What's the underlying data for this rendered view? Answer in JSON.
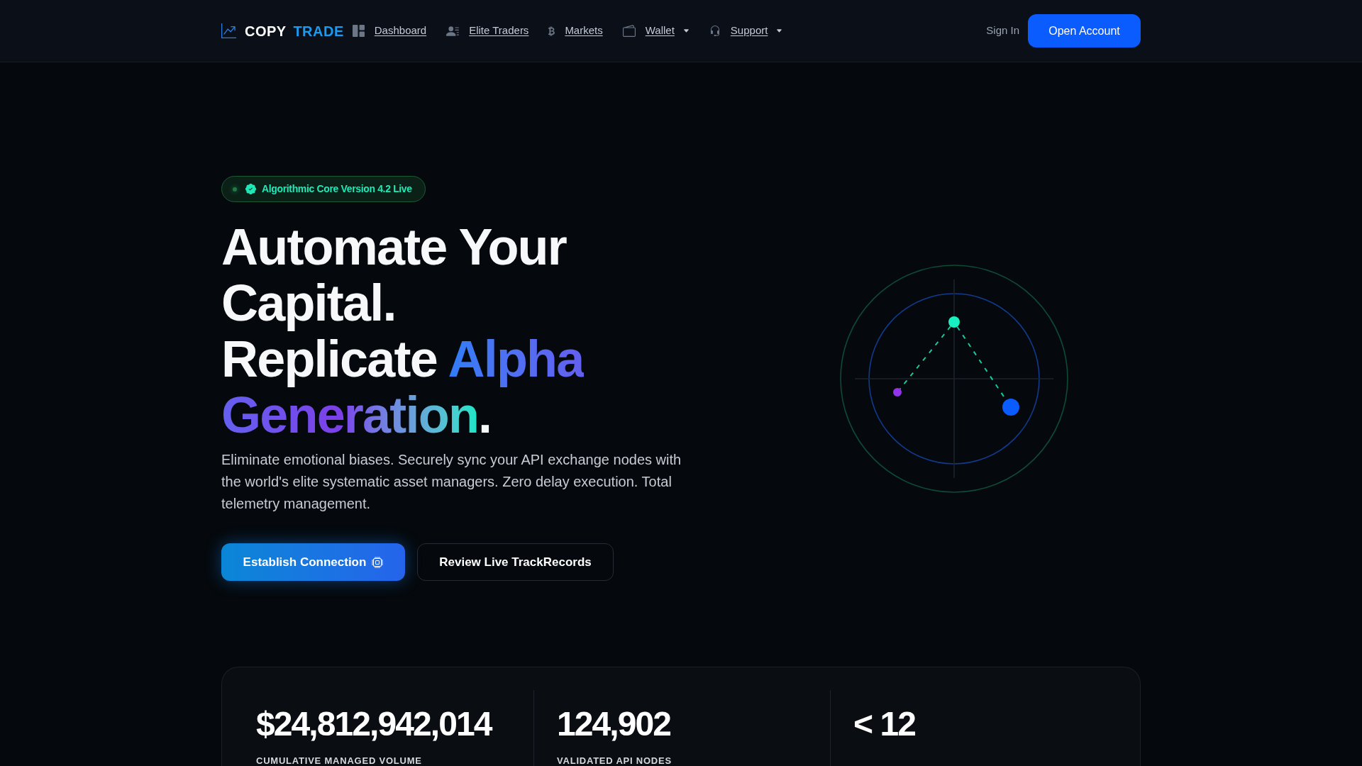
{
  "nav": {
    "brand": {
      "first": "COPY",
      "second": "TRADE"
    },
    "links": [
      {
        "label": "Dashboard",
        "has_dropdown": false
      },
      {
        "label": "Elite Traders",
        "has_dropdown": false
      },
      {
        "label": "Markets",
        "has_dropdown": false
      },
      {
        "label": "Wallet",
        "has_dropdown": true
      },
      {
        "label": "Support",
        "has_dropdown": true
      }
    ],
    "sign_in": "Sign In",
    "cta": "Open Account"
  },
  "hero": {
    "badge": "Algorithmic Core Version 4.2 Live",
    "headline": {
      "line_1": "Automate Your Capital.",
      "lead": "Replicate",
      "highlight": "Alpha Generation",
      "end": "."
    },
    "description": "Eliminate emotional biases. Securely sync your API exchange nodes with the world's elite systematic asset managers. Zero delay execution. Total telemetry management.",
    "buttons": [
      {
        "label": "Establish Connection",
        "kind": "primary"
      },
      {
        "label": "Review Live TrackRecords",
        "kind": "secondary"
      }
    ]
  },
  "stats": [
    {
      "value": "$24,812,942,014",
      "label": "CUMULATIVE MANAGED VOLUME"
    },
    {
      "value": "124,902",
      "label": "VALIDATED API NODES"
    },
    {
      "value": "< 12"
    }
  ]
}
